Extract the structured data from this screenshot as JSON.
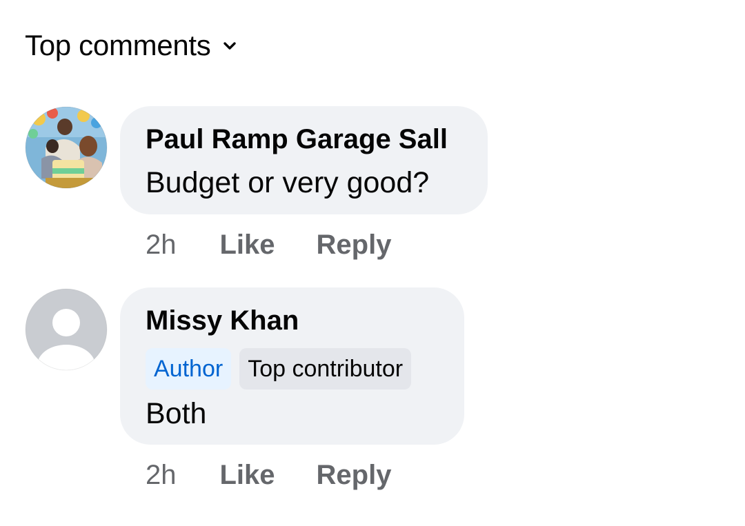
{
  "sort": {
    "label": "Top comments",
    "icon": "chevron-down-icon"
  },
  "comments": [
    {
      "author": "Paul Ramp Garage Sall",
      "text": "Budget or very good?",
      "time": "2h",
      "like_label": "Like",
      "reply_label": "Reply",
      "avatar": "photo-avatar"
    },
    {
      "author": "Missy Khan",
      "badges": [
        "Author",
        "Top contributor"
      ],
      "text": "Both",
      "time": "2h",
      "like_label": "Like",
      "reply_label": "Reply",
      "avatar": "default-avatar"
    }
  ],
  "colors": {
    "bubble": "#f0f2f5",
    "meta_text": "#65676b",
    "author_badge_bg": "#e7f3ff",
    "author_badge_text": "#0064d1",
    "contributor_badge_bg": "#e4e6eb"
  }
}
